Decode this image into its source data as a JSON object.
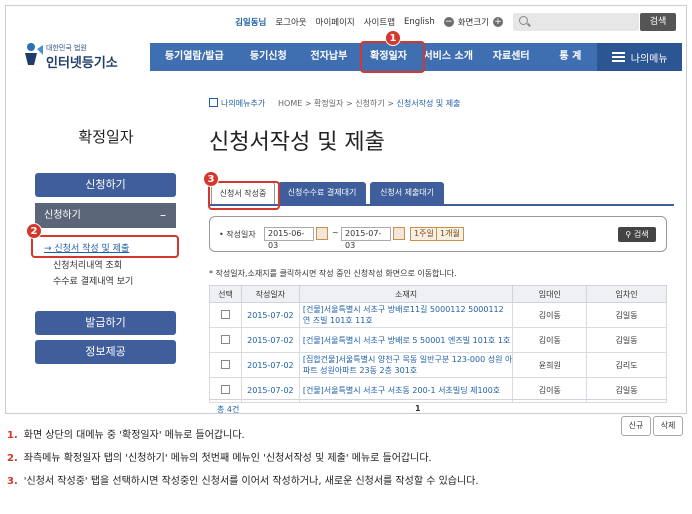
{
  "util": {
    "user": "김일동님",
    "logout": "로그아웃",
    "mypage": "마이페이지",
    "sitemap": "사이트맵",
    "english": "English",
    "zoom_label": "화면크기",
    "search_button": "검색"
  },
  "logo": {
    "small": "대한민국 법원",
    "big": "인터넷등기소"
  },
  "nav": {
    "items": [
      "등기열람/발급",
      "등기신청",
      "전자납부",
      "확정일자",
      "서비스 소개",
      "자료센터",
      "통 계"
    ],
    "my_menu": "나의메뉴"
  },
  "breadcrumb": {
    "bookmark": "나의메뉴추가",
    "path": "HOME > 확정일자 > 신청하기 > ",
    "current": "신청서작성 및 제출"
  },
  "sidebar": {
    "title": "확정일자",
    "top_button": "신청하기",
    "section": "신청하기",
    "section_toggle": "–",
    "subitems": [
      "→ 신청서 작성 및 제출",
      "신청처리내역 조회",
      "수수료 결제내역 보기"
    ],
    "bottom_buttons": [
      "발급하기",
      "정보제공"
    ]
  },
  "page_title": "신청서작성 및 제출",
  "tabs": [
    "신청서 작성중",
    "신청수수료 결제대기",
    "신청서 제출대기"
  ],
  "search": {
    "label": "• 작성일자",
    "from": "2015-06-03",
    "to": "2015-07-03",
    "tilde": "~",
    "week": "1주일",
    "month": "1개월",
    "button": "검색"
  },
  "note": "* 작성일자,소재지를 클릭하시면 작성 중인 신청작성 화면으로 이동합니다.",
  "table": {
    "headers": [
      "선택",
      "작성일자",
      "소재지",
      "임대인",
      "임차인"
    ],
    "rows": [
      {
        "date": "2015-07-02",
        "address": "[건물]서울특별시 서초구 방배로11길 5000112 5000112 연 즈빌 101호 11호",
        "lessor": "김이동",
        "lessee": "김일동"
      },
      {
        "date": "2015-07-02",
        "address": "[건물]서울특별시 서초구 방배로 5 50001 엔즈빌 101호 1호",
        "lessor": "김이동",
        "lessee": "김일동"
      },
      {
        "date": "2015-07-02",
        "address": "[집합건물]서울특별시 양천구 목동 일반구분 123-000 성원 아파트 성원아파트 23동 2층 301호",
        "lessor": "윤희원",
        "lessee": "김리도"
      },
      {
        "date": "2015-07-02",
        "address": "[건물]서울특별시 서초구 서초동 200-1 서초빌딩 제100호",
        "lessor": "김이동",
        "lessee": "김일동"
      }
    ],
    "total": "총 4건",
    "page": "1"
  },
  "buttons": {
    "new": "신규",
    "delete": "삭제"
  },
  "badges": [
    "1",
    "2",
    "3"
  ],
  "instructions": [
    {
      "num": "1.",
      "text": "화면 상단의 대메뉴 중 '확정일자' 메뉴로 들어갑니다."
    },
    {
      "num": "2.",
      "text": "좌측메뉴 확정일자 탭의 '신청하기' 메뉴의 첫번째 메뉴인 '신청서작성 및 제출' 메뉴로 들어갑니다."
    },
    {
      "num": "3.",
      "text": "'신청서 작성중' 탭을 선택하시면 작성중인 신청서를 이어서 작성하거나, 새로운 신청서를 작성할 수 있습니다."
    }
  ],
  "colors": {
    "accent": "#3f6fb0",
    "sidebar": "#3f5e9b",
    "highlight": "#d4372b"
  }
}
